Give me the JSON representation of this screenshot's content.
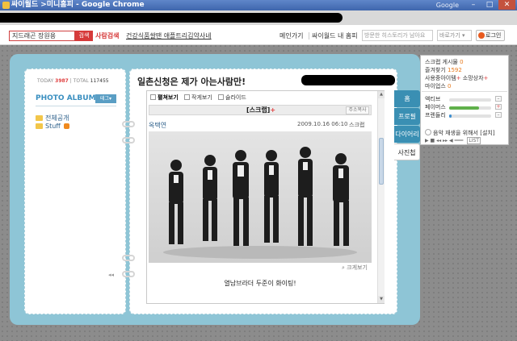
{
  "window": {
    "title": "싸이월드 >미니홈피 - Google Chrome",
    "brand": "Google",
    "minimize": "–",
    "maximize": "□",
    "close": "✕"
  },
  "toolbar": {
    "search_value": "지드래곤 장원용",
    "search_button": "검색",
    "people_search": "사람검색",
    "ad_link": "건강식품쌀땐 애플트리김약사네",
    "main_link": "메인가기",
    "my_homepage_link": "싸이월드 내 홈피",
    "history_placeholder": "방문한 히스토리가 남아요",
    "goto_select": "바로가기",
    "login_button": "로그인"
  },
  "left_page": {
    "today_label": "TODAY",
    "today_count": "3987",
    "total_label": "TOTAL",
    "total_count": "117455",
    "album_title": "PHOTO ALBUM",
    "manage_button": "테그",
    "folders": [
      {
        "label": "전체공개"
      },
      {
        "label": "Stuff"
      }
    ],
    "collapse": "◂◂"
  },
  "right_page": {
    "homepage_title": "일촌신청은 제가 아는사람만!",
    "view_tabs": [
      "펼쳐보기",
      "작게보기",
      "슬라이드"
    ],
    "scrap_label": "[스크랩]",
    "scrap_plus": "+",
    "address_button": "주소복사",
    "post_author": "옥택연",
    "post_date": "2009.10.16 06:10",
    "post_scrap": "스크랩",
    "zoom_link": "크게보기",
    "caption": "열남브라더 두준이 화이팅!"
  },
  "side_tabs": [
    "홈",
    "프로필",
    "다이어리",
    "사진첩"
  ],
  "side_panel": {
    "scrap_posts_label": "스크랩 게시물",
    "scrap_posts_count": "0",
    "favorites_label": "즐겨찾기",
    "favorites_count": "1592",
    "items_label": "사용중아이템",
    "items_plus": "+",
    "owner_label": "소망상자",
    "owner_plus": "+",
    "mypeople_label": "마이업스",
    "mypeople_count": "0",
    "moods": [
      {
        "label": "액티브",
        "level": 0.0,
        "color": "#5fb04a"
      },
      {
        "label": "페이머스",
        "level": 0.72,
        "color": "#5fb04a"
      },
      {
        "label": "프렌들리",
        "level": 0.05,
        "color": "#3f8fd0"
      }
    ],
    "music_label": "음악 재생을 위해서",
    "music_install": "[설치]",
    "player_list": "LIST"
  },
  "colors": {
    "accent_red": "#d63a3a",
    "book_blue": "#8ec5d6",
    "tab_blue": "#3a8fb3",
    "link_blue": "#2c5f8a"
  }
}
